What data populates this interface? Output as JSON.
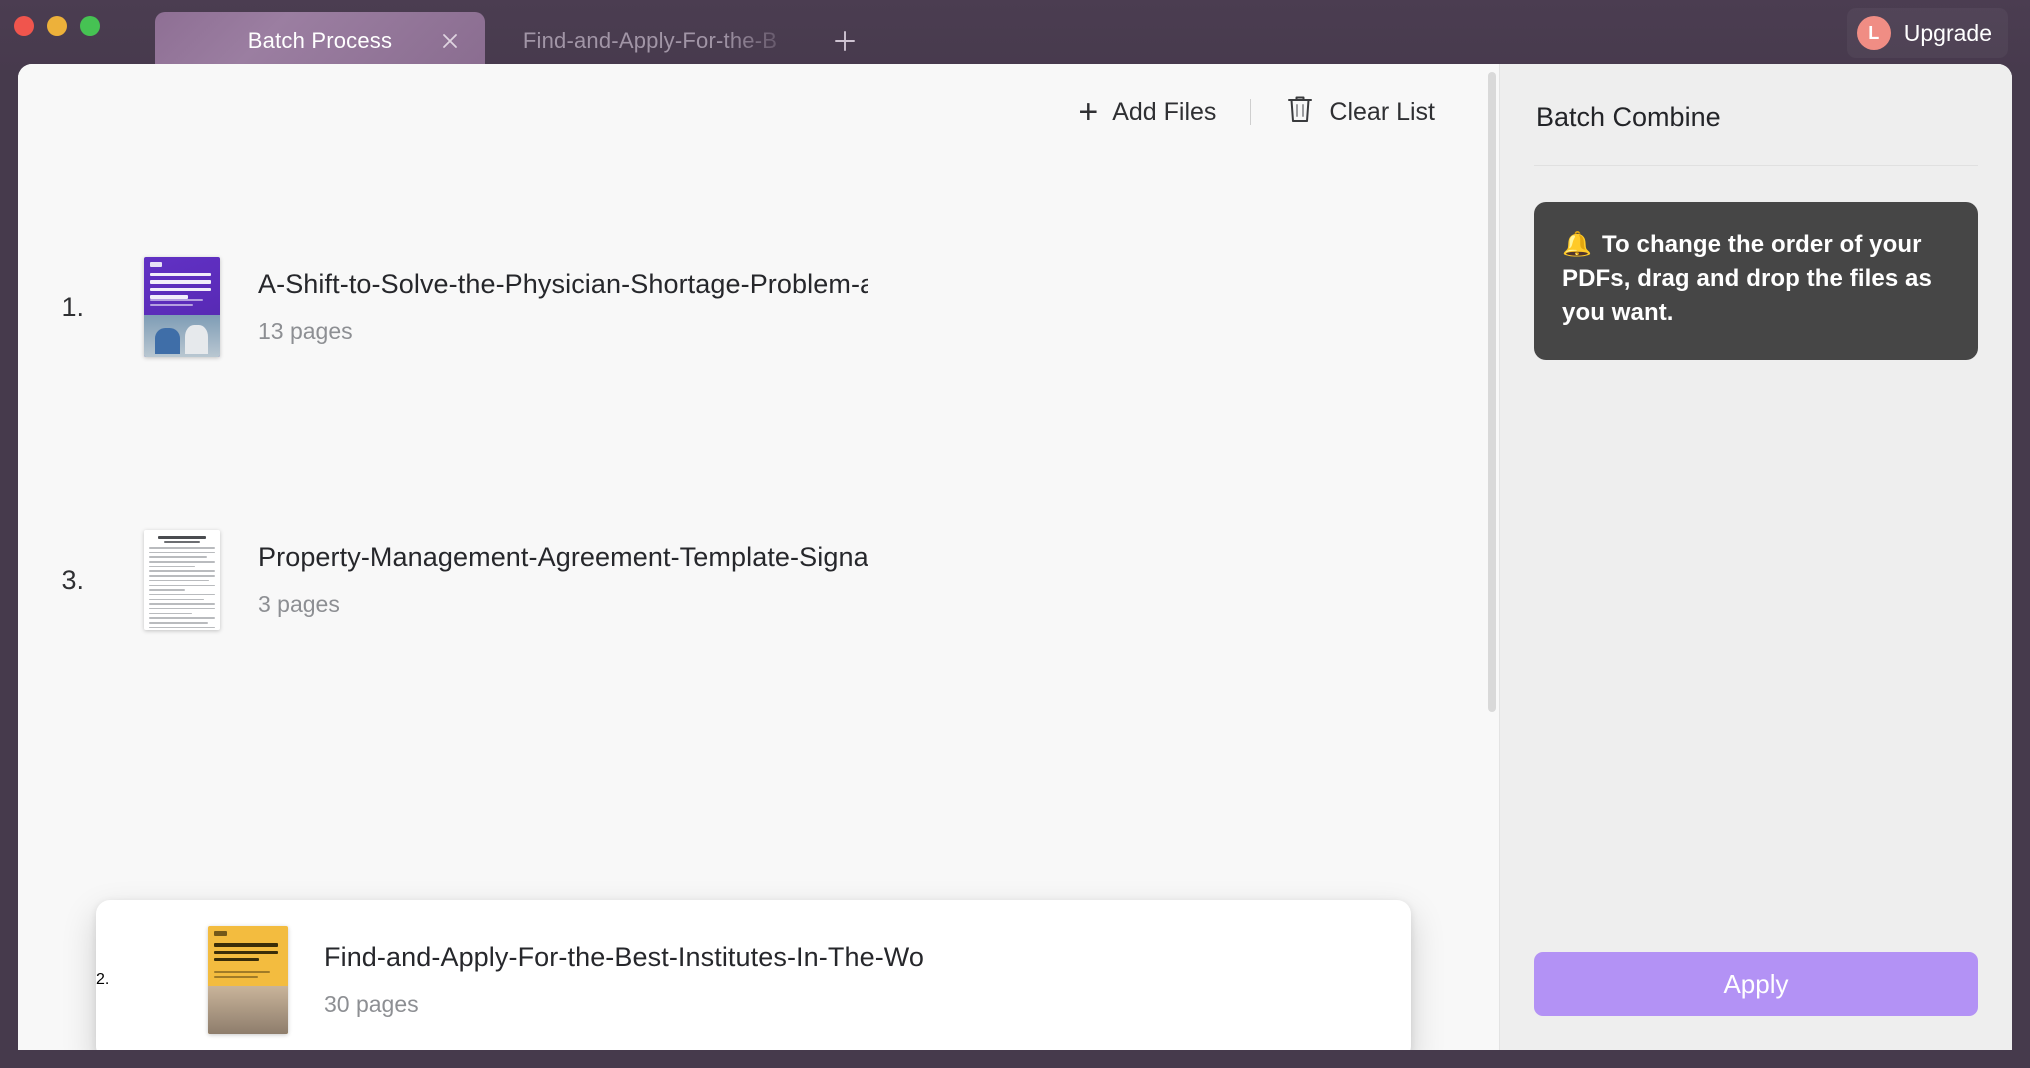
{
  "titlebar": {
    "traffic_lights": [
      {
        "name": "close",
        "color": "#f0554d"
      },
      {
        "name": "minimize",
        "color": "#edb13a"
      },
      {
        "name": "maximize",
        "color": "#46c253"
      }
    ],
    "tabs": [
      {
        "label": "Batch Process",
        "active": true,
        "close_icon": "×"
      },
      {
        "label": "Find-and-Apply-For-the-B",
        "active": false
      }
    ],
    "new_tab_icon": "+",
    "upgrade": {
      "avatar_letter": "L",
      "avatar_color": "#f08d84",
      "label": "Upgrade"
    }
  },
  "toolbar": {
    "add_files_label": "Add Files",
    "add_files_icon": "+",
    "clear_list_label": "Clear List",
    "clear_list_icon": "trash-icon"
  },
  "files": [
    {
      "index": "1.",
      "name": "A-Shift-to-Solve-the-Physician-Shortage-Problem-ar",
      "pages": "13 pages",
      "thumb_style": "purple-report"
    },
    {
      "index": "3.",
      "name": "Property-Management-Agreement-Template-Signatur",
      "pages": "3 pages",
      "thumb_style": "white-document"
    }
  ],
  "dragged_file": {
    "index": "2.",
    "name": "Find-and-Apply-For-the-Best-Institutes-In-The-Worlc",
    "pages": "30 pages",
    "thumb_style": "gold-brochure"
  },
  "sidebar": {
    "title": "Batch Combine",
    "tip": {
      "emoji": "🔔",
      "text": "To change the order of your PDFs, drag and drop the files as you want."
    },
    "apply_label": "Apply",
    "apply_color": "#b392f5"
  }
}
